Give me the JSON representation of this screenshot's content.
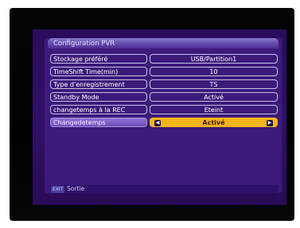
{
  "screen": {
    "title": "Configuration PVR"
  },
  "settings": [
    {
      "label": "Stockage préféré",
      "value": "USB/Partition1"
    },
    {
      "label": "TimeShift Time(min)",
      "value": "10"
    },
    {
      "label": "Type d'enregistrement",
      "value": "TS"
    },
    {
      "label": "Standby Mode",
      "value": "Activé"
    },
    {
      "label": "changetemps à la REC",
      "value": "Eteint"
    },
    {
      "label": "Changedetemps",
      "value": "Activé",
      "selected": true
    }
  ],
  "footer": {
    "exit_key": "EXIT",
    "exit_label": "Sortie"
  },
  "icons": {
    "left": "arrow-left-icon",
    "right": "arrow-right-icon"
  },
  "colors": {
    "background": "#2a0c5c",
    "selection": "#f4b41b",
    "title_bar": "#6a50b0"
  }
}
